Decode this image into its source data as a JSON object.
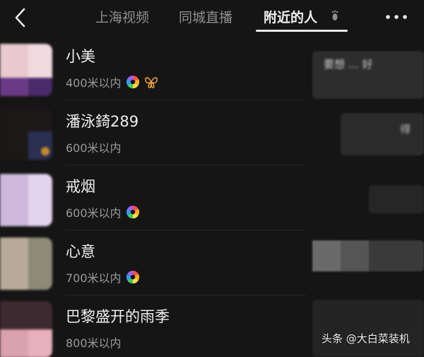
{
  "header": {
    "tabs": [
      {
        "label": "上海视频"
      },
      {
        "label": "同城直播"
      },
      {
        "label": "附近的人"
      }
    ]
  },
  "users": [
    {
      "name": "小美",
      "distance": "400米以内"
    },
    {
      "name": "潘泳錡289",
      "distance": "600米以内"
    },
    {
      "name": "戒烟",
      "distance": "600米以内"
    },
    {
      "name": "心意",
      "distance": "700米以内"
    },
    {
      "name": "巴黎盛开的雨季",
      "distance": "800米以内"
    }
  ],
  "right_panel": {
    "snippet_1": "要想 … 好",
    "snippet_2": "得"
  },
  "watermark": "头条 @大白菜装机",
  "colors": {
    "background": "#151515",
    "active_tab": "#f2f2f2",
    "inactive_tab": "#8f8f8f"
  },
  "icons": [
    "chevron-left-icon",
    "footprint-icon",
    "more-dots-icon",
    "rainbow-aperture-icon",
    "butterfly-icon"
  ]
}
